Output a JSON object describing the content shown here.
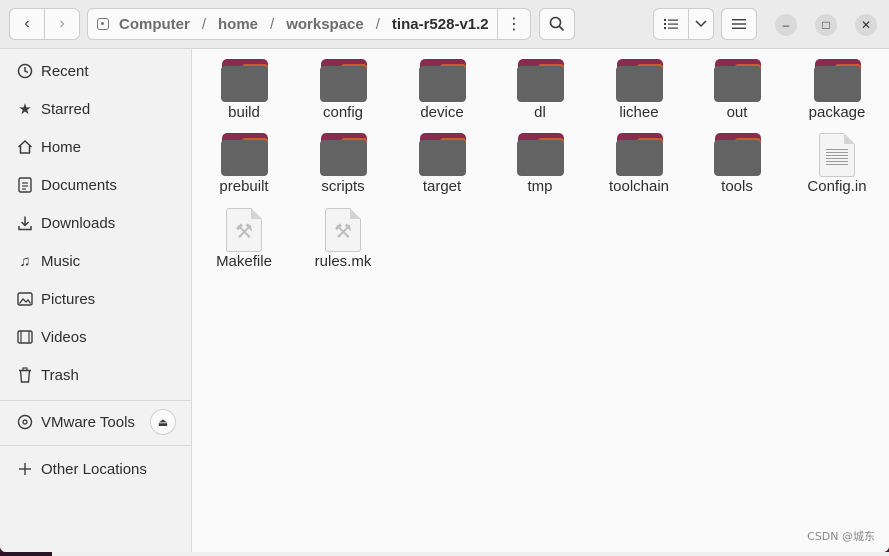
{
  "header": {
    "back_icon": "chevron-left",
    "forward_icon": "chevron-right",
    "path": [
      "Computer",
      "home",
      "workspace",
      "tina-r528-v1.2"
    ],
    "path_separator": "/",
    "path_menu_glyph": "⋮",
    "search_glyph": "⌕",
    "list_view_glyph": "☰",
    "view_dropdown_glyph": "⌄",
    "main_menu_glyph": "≡",
    "minimize_glyph": "–",
    "maximize_glyph": "□",
    "close_glyph": "✕"
  },
  "sidebar": {
    "items": [
      {
        "label": "Recent",
        "icon": "clock-icon"
      },
      {
        "label": "Starred",
        "icon": "star-icon"
      },
      {
        "label": "Home",
        "icon": "home-icon"
      },
      {
        "label": "Documents",
        "icon": "document-icon"
      },
      {
        "label": "Downloads",
        "icon": "download-icon"
      },
      {
        "label": "Music",
        "icon": "music-icon"
      },
      {
        "label": "Pictures",
        "icon": "picture-icon"
      },
      {
        "label": "Videos",
        "icon": "video-icon"
      },
      {
        "label": "Trash",
        "icon": "trash-icon"
      }
    ],
    "devices": [
      {
        "label": "VMware Tools",
        "icon": "disc-icon"
      }
    ],
    "other": {
      "label": "Other Locations",
      "icon": "plus-icon"
    }
  },
  "files": [
    {
      "name": "build",
      "type": "folder"
    },
    {
      "name": "config",
      "type": "folder"
    },
    {
      "name": "device",
      "type": "folder"
    },
    {
      "name": "dl",
      "type": "folder"
    },
    {
      "name": "lichee",
      "type": "folder"
    },
    {
      "name": "out",
      "type": "folder"
    },
    {
      "name": "package",
      "type": "folder"
    },
    {
      "name": "prebuilt",
      "type": "folder"
    },
    {
      "name": "scripts",
      "type": "folder"
    },
    {
      "name": "target",
      "type": "folder"
    },
    {
      "name": "tmp",
      "type": "folder"
    },
    {
      "name": "toolchain",
      "type": "folder"
    },
    {
      "name": "tools",
      "type": "folder"
    },
    {
      "name": "Config.in",
      "type": "text"
    },
    {
      "name": "Makefile",
      "type": "script"
    },
    {
      "name": "rules.mk",
      "type": "script"
    }
  ],
  "watermark": "CSDN @城东",
  "colors": {
    "folder_tab": "#8a2b4e",
    "folder_accent": "#cc5a2c",
    "folder_body": "#636363"
  }
}
